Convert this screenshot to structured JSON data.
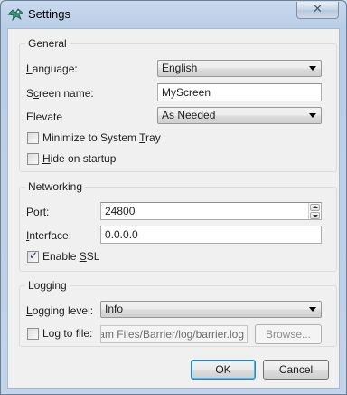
{
  "window": {
    "title": "Settings",
    "close_glyph": "✕"
  },
  "general": {
    "title": "General",
    "language_label": "Language:",
    "language_value": "English",
    "screen_name_label": "Screen name:",
    "screen_name_value": "MyScreen",
    "elevate_label": "Elevate",
    "elevate_value": "As Needed",
    "minimize_label": "Minimize to System Tray",
    "minimize_checked": false,
    "hide_label": "Hide on startup",
    "hide_checked": false
  },
  "networking": {
    "title": "Networking",
    "port_label": "Port:",
    "port_value": "24800",
    "interface_label": "Interface:",
    "interface_value": "0.0.0.0",
    "ssl_label": "Enable SSL",
    "ssl_checked": true
  },
  "logging": {
    "title": "Logging",
    "level_label": "Logging level:",
    "level_value": "Info",
    "log_to_file_label": "Log to file:",
    "log_to_file_checked": false,
    "log_path_value": "gram Files/Barrier/log/barrier.log",
    "browse_label": "Browse..."
  },
  "buttons": {
    "ok": "OK",
    "cancel": "Cancel"
  },
  "icons": {
    "app": "barrier-logo-icon",
    "check": "✓"
  }
}
